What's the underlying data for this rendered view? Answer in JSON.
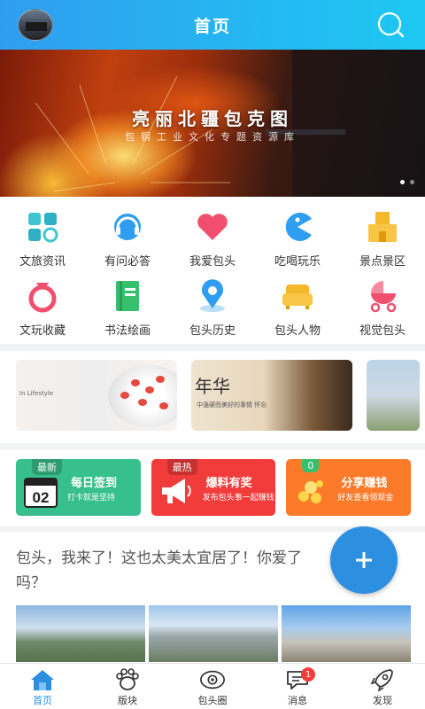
{
  "header": {
    "title": "首页"
  },
  "banner": {
    "title": "亮丽北疆包克图",
    "subtitle": "包钢工业文化专题资源库",
    "page_count": 2,
    "current_page": 1
  },
  "grid": {
    "row1": [
      {
        "label": "文旅资讯",
        "icon": "grid-icon",
        "color": "#3ec5d2"
      },
      {
        "label": "有问必答",
        "icon": "headset-icon",
        "color": "#2f9ef0"
      },
      {
        "label": "我爱包头",
        "icon": "heart-icon",
        "color": "#f0506e"
      },
      {
        "label": "吃喝玩乐",
        "icon": "pacman-icon",
        "color": "#2f9ef0"
      },
      {
        "label": "景点景区",
        "icon": "building-icon",
        "color": "#f5b82a"
      }
    ],
    "row2": [
      {
        "label": "文玩收藏",
        "icon": "ring-icon",
        "color": "#f0506e"
      },
      {
        "label": "书法绘画",
        "icon": "book-icon",
        "color": "#37bf6d"
      },
      {
        "label": "包头历史",
        "icon": "location-icon",
        "color": "#2f9ef0"
      },
      {
        "label": "包头人物",
        "icon": "sofa-icon",
        "color": "#f5b82a"
      },
      {
        "label": "视觉包头",
        "icon": "stroller-icon",
        "color": "#f0506e"
      }
    ]
  },
  "cards": [
    {
      "text": "In Lifestyle"
    },
    {
      "big": "年华",
      "small": "中强硬而美好的事情 怀忘"
    }
  ],
  "promos": [
    {
      "tag": "最新",
      "title": "每日签到",
      "sub": "打卡就是坚持",
      "color": "#37bf8d",
      "icon": "calendar-icon",
      "calendar_day": "02"
    },
    {
      "tag": "最热",
      "title": "爆料有奖",
      "sub": "发布包头事一起赚钱",
      "color": "#f23b3b",
      "icon": "megaphone-icon"
    },
    {
      "tag": "0",
      "title": "分享赚钱",
      "sub": "好友查看领现金",
      "color": "#fb7b2a",
      "icon": "coins-icon"
    }
  ],
  "post": {
    "text": "包头，我来了！这也太美太宜居了！你爱了吗？"
  },
  "fab": {
    "icon": "plus-icon"
  },
  "tabbar": [
    {
      "label": "首页",
      "icon": "home-icon",
      "active": true
    },
    {
      "label": "版块",
      "icon": "paw-icon",
      "active": false
    },
    {
      "label": "包头圈",
      "icon": "eye-icon",
      "active": false
    },
    {
      "label": "消息",
      "icon": "chat-icon",
      "active": false,
      "badge": "1"
    },
    {
      "label": "发现",
      "icon": "rocket-icon",
      "active": false
    }
  ]
}
